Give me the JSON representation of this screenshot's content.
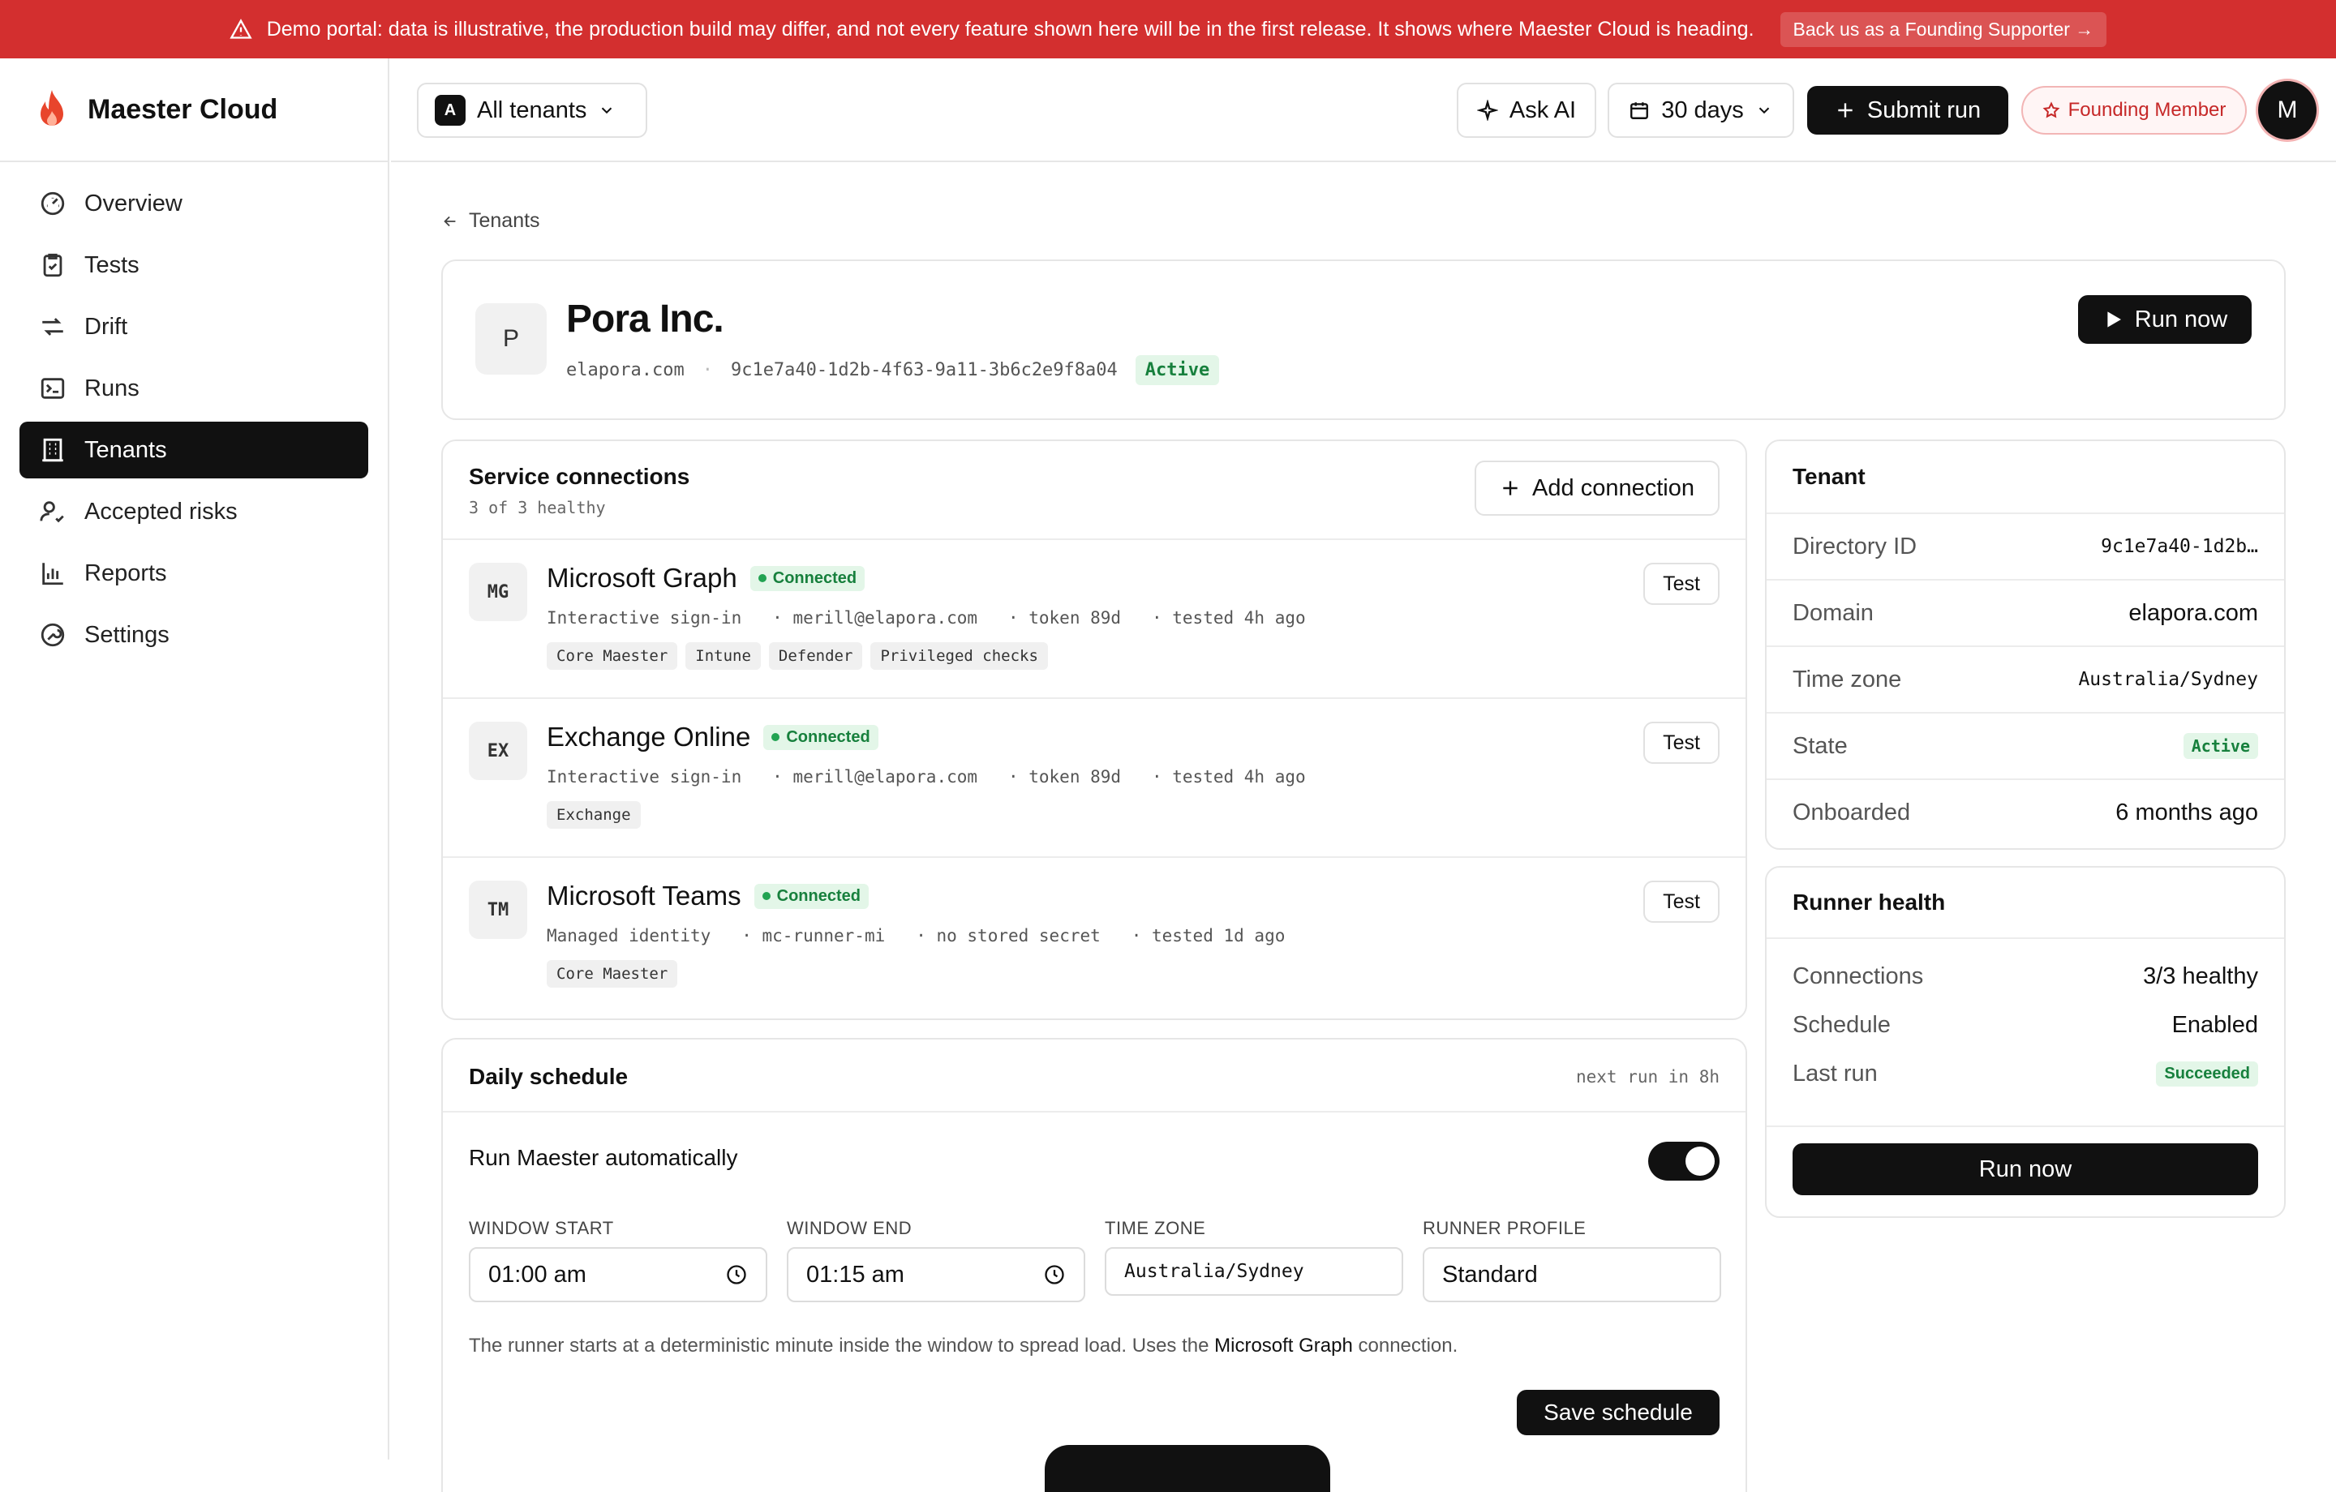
{
  "banner": {
    "text": "Demo portal: data is illustrative, the production build may differ, and not every feature shown here will be in the first release. It shows where Maester Cloud is heading.",
    "cta": "Back us as a Founding Supporter →"
  },
  "brand": {
    "name": "Maester Cloud"
  },
  "nav": [
    {
      "label": "Overview",
      "icon": "gauge-icon"
    },
    {
      "label": "Tests",
      "icon": "clipboard-check-icon"
    },
    {
      "label": "Drift",
      "icon": "arrows-icon"
    },
    {
      "label": "Runs",
      "icon": "terminal-icon"
    },
    {
      "label": "Tenants",
      "icon": "building-icon"
    },
    {
      "label": "Accepted risks",
      "icon": "user-check-icon"
    },
    {
      "label": "Reports",
      "icon": "chart-icon"
    },
    {
      "label": "Settings",
      "icon": "wrench-icon"
    }
  ],
  "topbar": {
    "tenant_badge": "A",
    "tenant_label": "All tenants",
    "ask_ai": "Ask AI",
    "range": "30 days",
    "submit_run": "Submit run",
    "founding": "Founding Member",
    "avatar": "M"
  },
  "breadcrumb": {
    "back": "Tenants"
  },
  "tenant": {
    "avatar": "P",
    "name": "Pora Inc.",
    "domain": "elapora.com",
    "id": "9c1e7a40-1d2b-4f63-9a11-3b6c2e9f8a04",
    "status": "Active",
    "run_now": "Run now"
  },
  "connections": {
    "title": "Service connections",
    "subtitle": "3 of 3 healthy",
    "add": "Add connection",
    "items": [
      {
        "abbr": "MG",
        "name": "Microsoft Graph",
        "status": "Connected",
        "m1": "Interactive sign-in",
        "m2": "· merill@elapora.com",
        "m3": "· token 89d",
        "m4": "· tested 4h ago",
        "tags": [
          "Core Maester",
          "Intune",
          "Defender",
          "Privileged checks"
        ],
        "test": "Test"
      },
      {
        "abbr": "EX",
        "name": "Exchange Online",
        "status": "Connected",
        "m1": "Interactive sign-in",
        "m2": "· merill@elapora.com",
        "m3": "· token 89d",
        "m4": "· tested 4h ago",
        "tags": [
          "Exchange"
        ],
        "test": "Test"
      },
      {
        "abbr": "TM",
        "name": "Microsoft Teams",
        "status": "Connected",
        "m1": "Managed identity",
        "m2": "· mc-runner-mi",
        "m3": "· no stored secret",
        "m4": "· tested 1d ago",
        "tags": [
          "Core Maester"
        ],
        "test": "Test"
      }
    ]
  },
  "schedule": {
    "title": "Daily schedule",
    "next": "next run in 8h",
    "auto_label": "Run Maester automatically",
    "enabled": true,
    "labels": {
      "start": "WINDOW START",
      "end": "WINDOW END",
      "tz": "TIME ZONE",
      "profile": "RUNNER PROFILE"
    },
    "values": {
      "start": "01:00 am",
      "end": "01:15 am",
      "tz": "Australia/Sydney",
      "profile": "Standard"
    },
    "note_pre": "The runner starts at a deterministic minute inside the window to spread load. Uses the ",
    "note_strong": "Microsoft Graph",
    "note_post": " connection.",
    "save": "Save schedule"
  },
  "tenant_panel": {
    "title": "Tenant",
    "rows": [
      {
        "k": "Directory ID",
        "v": "9c1e7a40-1d2b…"
      },
      {
        "k": "Domain",
        "v": "elapora.com"
      },
      {
        "k": "Time zone",
        "v": "Australia/Sydney"
      },
      {
        "k": "State",
        "v": "Active"
      },
      {
        "k": "Onboarded",
        "v": "6 months ago"
      }
    ]
  },
  "runner": {
    "title": "Runner health",
    "rows": [
      {
        "k": "Connections",
        "v": "3/3 healthy"
      },
      {
        "k": "Schedule",
        "v": "Enabled"
      },
      {
        "k": "Last run",
        "v": "Succeeded"
      }
    ],
    "run_now": "Run now"
  },
  "colors": {
    "accent": "#111111",
    "banner": "#d32f2f",
    "success": "#17803d",
    "brand_flame": "#e8452c"
  }
}
